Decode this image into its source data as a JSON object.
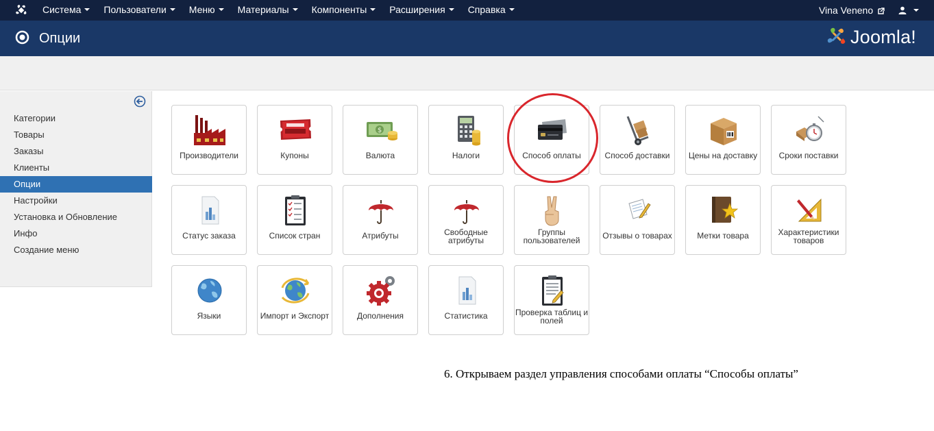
{
  "topbar": {
    "menu": [
      {
        "label": "Система"
      },
      {
        "label": "Пользователи"
      },
      {
        "label": "Меню"
      },
      {
        "label": "Материалы"
      },
      {
        "label": "Компоненты"
      },
      {
        "label": "Расширения"
      },
      {
        "label": "Справка"
      }
    ],
    "site_name": "Vina Veneno"
  },
  "header": {
    "title": "Опции",
    "brand": "Joomla!"
  },
  "sidebar": {
    "items": [
      {
        "label": "Категории",
        "active": false
      },
      {
        "label": "Товары",
        "active": false
      },
      {
        "label": "Заказы",
        "active": false
      },
      {
        "label": "Клиенты",
        "active": false
      },
      {
        "label": "Опции",
        "active": true
      },
      {
        "label": "Настройки",
        "active": false
      },
      {
        "label": "Установка и Обновление",
        "active": false
      },
      {
        "label": "Инфо",
        "active": false
      },
      {
        "label": "Создание меню",
        "active": false
      }
    ]
  },
  "tiles": [
    {
      "label": "Производители",
      "icon": "factory-icon"
    },
    {
      "label": "Купоны",
      "icon": "coupon-icon"
    },
    {
      "label": "Валюта",
      "icon": "currency-icon"
    },
    {
      "label": "Налоги",
      "icon": "calculator-icon"
    },
    {
      "label": "Способ оплаты",
      "icon": "credit-card-icon"
    },
    {
      "label": "Способ доставки",
      "icon": "hand-truck-icon"
    },
    {
      "label": "Цены на доставку",
      "icon": "package-icon"
    },
    {
      "label": "Сроки поставки",
      "icon": "stopwatch-icon"
    },
    {
      "label": "Статус заказа",
      "icon": "report-icon"
    },
    {
      "label": "Список стран",
      "icon": "checklist-icon"
    },
    {
      "label": "Атрибуты",
      "icon": "umbrella-icon"
    },
    {
      "label": "Свободные атрибуты",
      "icon": "umbrella-icon"
    },
    {
      "label": "Группы пользователей",
      "icon": "victory-hand-icon"
    },
    {
      "label": "Отзывы о товарах",
      "icon": "note-pencil-icon"
    },
    {
      "label": "Метки товара",
      "icon": "book-star-icon"
    },
    {
      "label": "Характеристики товаров",
      "icon": "ruler-pencil-icon"
    },
    {
      "label": "Языки",
      "icon": "globe-icon"
    },
    {
      "label": "Импорт и Экспорт",
      "icon": "globe-arrows-icon"
    },
    {
      "label": "Дополнения",
      "icon": "gears-icon"
    },
    {
      "label": "Статистика",
      "icon": "report-icon"
    },
    {
      "label": "Проверка таблиц и полей",
      "icon": "clipboard-icon"
    }
  ],
  "highlighted_tile": "Способ оплаты",
  "caption": "6. Открываем раздел управления способами оплаты “Способы оплаты”",
  "colors": {
    "navbar": "#12213f",
    "titlebar": "#1a3867",
    "active_item": "#2f71b3",
    "highlight": "#d9262c"
  }
}
